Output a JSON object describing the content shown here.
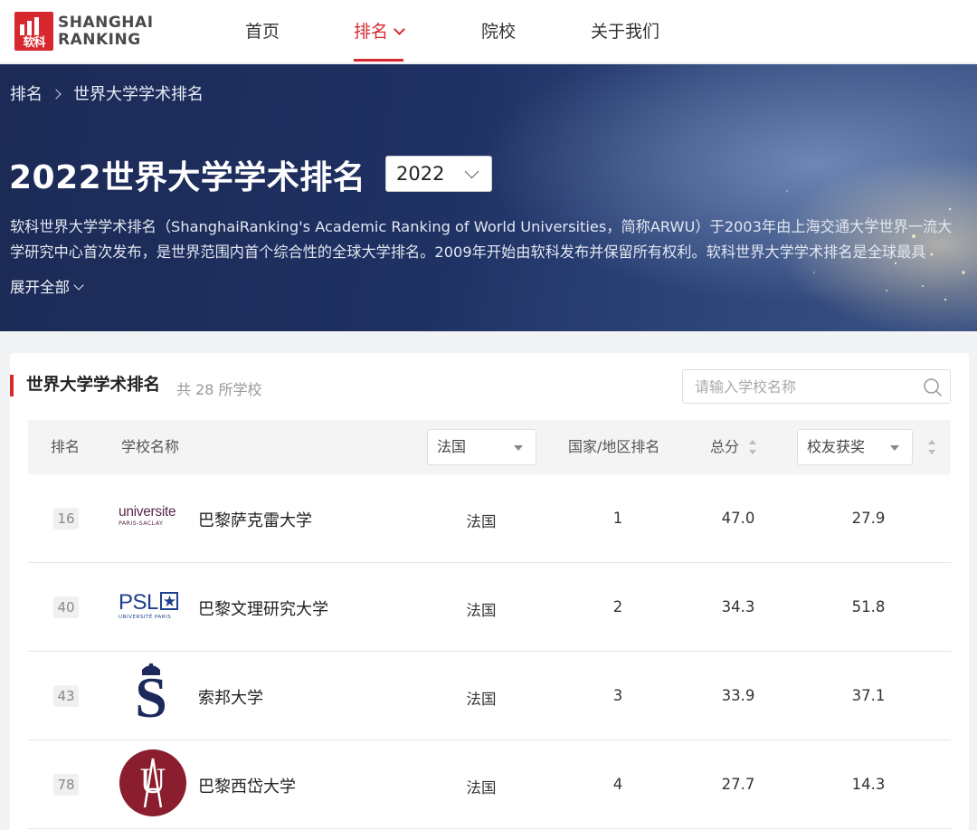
{
  "nav": {
    "logo_cn": "软科",
    "logo_line1": "SHANGHAI",
    "logo_line2": "RANKING",
    "items": [
      "首页",
      "排名",
      "院校",
      "关于我们"
    ]
  },
  "hero": {
    "breadcrumb": [
      "排名",
      "世界大学学术排名"
    ],
    "title": "2022世界大学学术排名",
    "year": "2022",
    "desc_line1": "软科世界大学学术排名（ShanghaiRanking's Academic Ranking of World Universities，简称ARWU）于2003年由上海交通大学世界一流大",
    "desc_line2": "学研究中心首次发布，是世界范围内首个综合性的全球大学排名。2009年开始由软科发布并保留所有权利。软科世界大学学术排名是全球最具",
    "expand_label": "展开全部"
  },
  "panel": {
    "title": "世界大学学术排名",
    "count": "共 28 所学校",
    "search_placeholder": "请输入学校名称"
  },
  "table": {
    "headers": {
      "rank": "排名",
      "name": "学校名称",
      "country_filter": "法国",
      "country_rank": "国家/地区排名",
      "score": "总分",
      "indicator": "校友获奖"
    },
    "rows": [
      {
        "rank": "16",
        "name": "巴黎萨克雷大学",
        "country": "法国",
        "country_rank": "1",
        "score": "47.0",
        "indicator": "27.9",
        "logo_l1": "universite",
        "logo_l2": "PARIS-SACLAY"
      },
      {
        "rank": "40",
        "name": "巴黎文理研究大学",
        "country": "法国",
        "country_rank": "2",
        "score": "34.3",
        "indicator": "51.8",
        "logo_l1": "PSL",
        "logo_l2": "UNIVERSITÉ PARIS"
      },
      {
        "rank": "43",
        "name": "索邦大学",
        "country": "法国",
        "country_rank": "3",
        "score": "33.9",
        "indicator": "37.1",
        "logo_l1": "S"
      },
      {
        "rank": "78",
        "name": "巴黎西岱大学",
        "country": "法国",
        "country_rank": "4",
        "score": "27.7",
        "indicator": "14.3",
        "logo_l1": "U"
      }
    ]
  },
  "colors": {
    "brand_red": "#d7282f",
    "psl_blue": "#1d3f8f",
    "sorbonne_navy": "#1c2a5b",
    "citeu_maroon": "#8a1e2e",
    "saclay_purple": "#5a2a4a"
  }
}
